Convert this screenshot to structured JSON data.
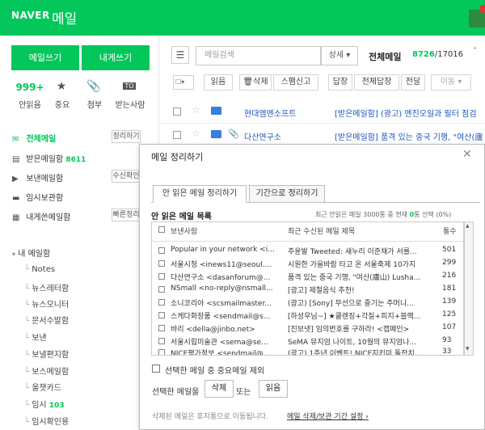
{
  "header": {
    "logo": "NAVER",
    "service": "메일"
  },
  "sidebar": {
    "write_label": "메일쓰기",
    "write_self_label": "내게쓰기",
    "quick": [
      {
        "value": "999+",
        "label": "안읽음"
      },
      {
        "icon": "★",
        "label": "중요"
      },
      {
        "icon": "📎",
        "label": "첨부"
      },
      {
        "icon": "TO",
        "label": "받는사람"
      }
    ],
    "mailboxes": [
      {
        "label": "전체메일",
        "icon": "✉",
        "tag": "정리하기"
      },
      {
        "label": "받은메일함",
        "count": "8611",
        "icon": "▤"
      },
      {
        "label": "보낸메일함",
        "icon": "▶",
        "tag": "수신확인"
      },
      {
        "label": "임시보관함",
        "icon": "▬"
      },
      {
        "label": "내게쓴메일함",
        "icon": "▦",
        "tag": "빠른정리"
      }
    ],
    "my_mailbox_label": "내 메일함",
    "folders": [
      {
        "label": "Notes"
      },
      {
        "label": "뉴스레터함"
      },
      {
        "label": "뉴스모니터"
      },
      {
        "label": "문서수발함"
      },
      {
        "label": "보낸"
      },
      {
        "label": "보낼편지함"
      },
      {
        "label": "보스메일함"
      },
      {
        "label": "올챗카드"
      },
      {
        "label": "임시",
        "count": "103"
      },
      {
        "label": "임시확인용"
      }
    ]
  },
  "toolbar": {
    "search_placeholder": "메일검색",
    "search_detail": "상세 ▾",
    "total_label": "전체메일",
    "total_unread": "8726",
    "total_all": "/17016",
    "buttons": [
      "읽음",
      "삭제",
      "스팸신고",
      "답장",
      "전체답장",
      "전달",
      "이동 ▾"
    ]
  },
  "mails": [
    {
      "sender": "현대엠엔소프트",
      "subject": "[받은메일함] (광고) 엔진오일과 필터 점검"
    },
    {
      "sender": "다산연구소",
      "subject": "[받은메일함] 품격 있는 중국 기행, \"여산(廬"
    }
  ],
  "modal": {
    "title": "메일 정리하기",
    "close": "✕",
    "tabs": [
      "안 읽은 메일 정리하기",
      "기간으로 정리하기"
    ],
    "list_title": "안 읽은 메일 목록",
    "list_info_prefix": "최근 안읽은 메일 3000통 중 현재 ",
    "list_info_count": "0",
    "list_info_suffix": "통 선택 (0%)",
    "columns": {
      "sender": "보낸사람",
      "subject": "최근 수신된 메일 제목",
      "count": "통수"
    },
    "rows": [
      {
        "sender": "Popular in your network <i...",
        "subject": "주윤발 Tweeted: 새누리 이준채가 서를...",
        "count": "501"
      },
      {
        "sender": "서울시청 <inews11@seoul....",
        "subject": "시원한 가을바람 타고 온 서울축제 10가지",
        "count": "299"
      },
      {
        "sender": "다산연구소 <dasanforum@...",
        "subject": "품격 있는 중국 기행, \"여산(廬山) Lusha...",
        "count": "216"
      },
      {
        "sender": "NSmall <no-reply@nsmall...",
        "subject": "[광고] 제철음식 추천!",
        "count": "181"
      },
      {
        "sender": "소니코리아 <scsmailmaster...",
        "subject": "(광고) [Sony] 무선으로 즐기는 주머니...",
        "count": "139"
      },
      {
        "sender": "스케다화장품 <sendmail@s...",
        "subject": "[하성우님~] ★클렌징+각질+피지+블랙...",
        "count": "125"
      },
      {
        "sender": "바리 <della@jinbo.net>",
        "subject": "[진보넷] 임의번호를 구하라! <캡페인>",
        "count": "107"
      },
      {
        "sender": "서울시립미술관 <sema@se...",
        "subject": "SeMA 뮤지엄 나이트, 10월의 뮤지엄나...",
        "count": "93"
      },
      {
        "sender": "NICE평가정보 <sendmail@...",
        "subject": "(광고) 1주년 이벤트! NICE지키미 돌잔치...",
        "count": "33"
      }
    ],
    "option_label": "선택한 메일 중 중요메일 제외",
    "action_label": "선택한 메일을",
    "delete_label": "삭제",
    "or_label": "또는",
    "read_label": "읽음",
    "notice": "삭제된 메일은 휴지통으로 이동됩니다.",
    "notice_link": "메일 삭제/보관 기간 설정 ›"
  }
}
